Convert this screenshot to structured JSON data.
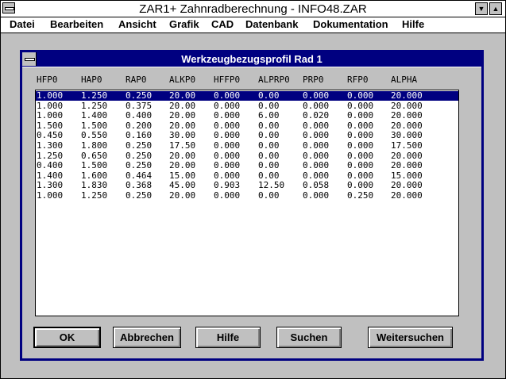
{
  "window": {
    "title": "ZAR1+ Zahnradberechnung  -  INFO48.ZAR"
  },
  "menubar": {
    "items": [
      "Datei",
      "Bearbeiten",
      "Ansicht",
      "Grafik",
      "CAD",
      "Datenbank",
      "Dokumentation",
      "Hilfe"
    ]
  },
  "dialog": {
    "title": "Werkzeugbezugsprofil Rad 1",
    "columns": [
      "HFP0",
      "HAP0",
      "RAP0",
      "ALKP0",
      "HFFP0",
      "ALPRP0",
      "PRP0",
      "RFP0",
      "ALPHA"
    ],
    "rows": [
      [
        "1.000",
        "1.250",
        "0.250",
        "20.00",
        "0.000",
        "0.00",
        "0.000",
        "0.000",
        "20.000"
      ],
      [
        "1.000",
        "1.250",
        "0.375",
        "20.00",
        "0.000",
        "0.00",
        "0.000",
        "0.000",
        "20.000"
      ],
      [
        "1.000",
        "1.400",
        "0.400",
        "20.00",
        "0.000",
        "6.00",
        "0.020",
        "0.000",
        "20.000"
      ],
      [
        "1.500",
        "1.500",
        "0.200",
        "20.00",
        "0.000",
        "0.00",
        "0.000",
        "0.000",
        "20.000"
      ],
      [
        "0.450",
        "0.550",
        "0.160",
        "30.00",
        "0.000",
        "0.00",
        "0.000",
        "0.000",
        "30.000"
      ],
      [
        "1.300",
        "1.800",
        "0.250",
        "17.50",
        "0.000",
        "0.00",
        "0.000",
        "0.000",
        "17.500"
      ],
      [
        "1.250",
        "0.650",
        "0.250",
        "20.00",
        "0.000",
        "0.00",
        "0.000",
        "0.000",
        "20.000"
      ],
      [
        "0.400",
        "1.500",
        "0.250",
        "20.00",
        "0.000",
        "0.00",
        "0.000",
        "0.000",
        "20.000"
      ],
      [
        "1.400",
        "1.600",
        "0.464",
        "15.00",
        "0.000",
        "0.00",
        "0.000",
        "0.000",
        "15.000"
      ],
      [
        "1.300",
        "1.830",
        "0.368",
        "45.00",
        "0.903",
        "12.50",
        "0.058",
        "0.000",
        "20.000"
      ],
      [
        "1.000",
        "1.250",
        "0.250",
        "20.00",
        "0.000",
        "0.00",
        "0.000",
        "0.250",
        "20.000"
      ]
    ],
    "selected_row": 0,
    "buttons": {
      "ok": "OK",
      "cancel": "Abbrechen",
      "help": "Hilfe",
      "search": "Suchen",
      "search_next": "Weitersuchen"
    }
  }
}
